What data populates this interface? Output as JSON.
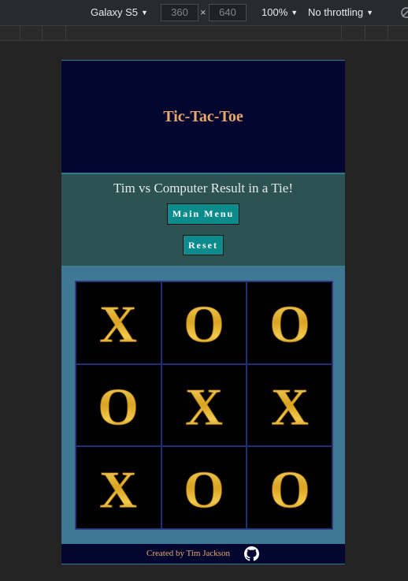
{
  "devtools": {
    "device": "Galaxy S5",
    "width": "360",
    "height": "640",
    "times": "×",
    "zoom": "100%",
    "throttling": "No throttling"
  },
  "app": {
    "title": "Tic-Tac-Toe",
    "status_message": "Tim vs Computer Result in a Tie!",
    "main_menu_label": "Main Menu",
    "reset_label": "Reset",
    "board": [
      "X",
      "O",
      "O",
      "O",
      "X",
      "X",
      "X",
      "O",
      "O"
    ],
    "footer_credit": "Created by Tim Jackson",
    "footer_icon": "github-icon"
  },
  "colors": {
    "header_bg": "#03062f",
    "title": "#e9a86a",
    "status_bg": "#2d5252",
    "button_bg": "#0b8b8b",
    "board_area_bg": "#3e7895",
    "piece_gold": "#e0b13a"
  }
}
